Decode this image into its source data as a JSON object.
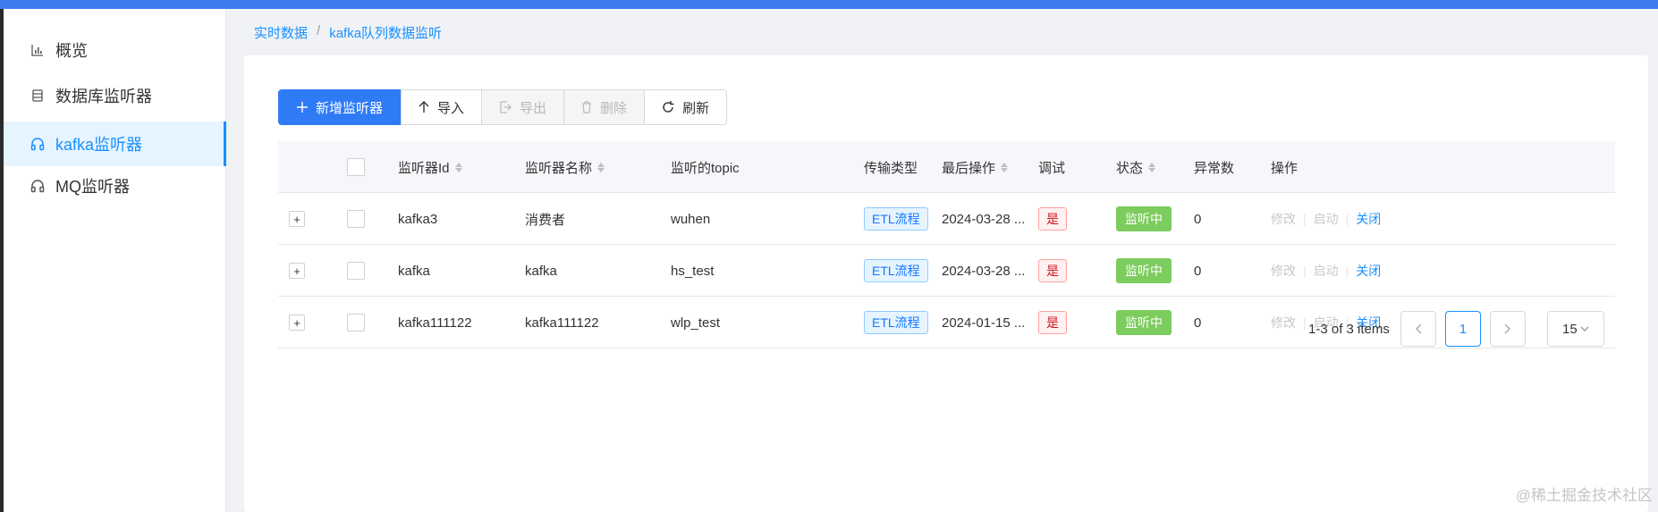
{
  "sidebar": {
    "items": [
      {
        "label": "概览",
        "icon": "bar-chart-icon"
      },
      {
        "label": "数据库监听器",
        "icon": "database-icon"
      },
      {
        "label": "kafka监听器",
        "icon": "headphones-icon",
        "active": true
      },
      {
        "label": "MQ监听器",
        "icon": "headphones-icon"
      }
    ]
  },
  "breadcrumb": {
    "items": [
      "实时数据",
      "kafka队列数据监听"
    ],
    "separator": "/"
  },
  "toolbar": {
    "add_label": "新增监听器",
    "import_label": "导入",
    "export_label": "导出",
    "delete_label": "删除",
    "refresh_label": "刷新"
  },
  "table": {
    "headers": {
      "id": "监听器Id",
      "name": "监听器名称",
      "topic": "监听的topic",
      "type": "传输类型",
      "last_op": "最后操作",
      "debug": "调试",
      "status": "状态",
      "errors": "异常数",
      "actions": "操作"
    },
    "rows": [
      {
        "id": "kafka3",
        "name": "消费者",
        "topic": "wuhen",
        "type": "ETL流程",
        "last_op": "2024-03-28 ...",
        "debug": "是",
        "status": "监听中",
        "errors": "0"
      },
      {
        "id": "kafka",
        "name": "kafka",
        "topic": "hs_test",
        "type": "ETL流程",
        "last_op": "2024-03-28 ...",
        "debug": "是",
        "status": "监听中",
        "errors": "0"
      },
      {
        "id": "kafka111122",
        "name": "kafka111122",
        "topic": "wlp_test",
        "type": "ETL流程",
        "last_op": "2024-01-15 ...",
        "debug": "是",
        "status": "监听中",
        "errors": "0"
      }
    ],
    "row_actions": {
      "edit": "修改",
      "start": "启动",
      "close": "关闭"
    },
    "expand_symbol": "+"
  },
  "pagination": {
    "summary": "1-3 of 3 items",
    "current_page": "1",
    "page_size": "15"
  },
  "watermark": "@稀土掘金技术社区",
  "colors": {
    "primary": "#2f7bf5",
    "active_link": "#1890ff",
    "status_on": "#7ccc5e",
    "tag_danger": "#cf1322"
  }
}
